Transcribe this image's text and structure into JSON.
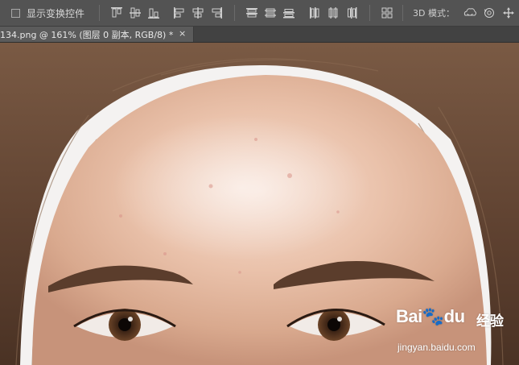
{
  "options_bar": {
    "show_transform_controls": {
      "label": "显示变换控件",
      "checked": false
    },
    "align_icons": [
      "align-top-edges-icon",
      "align-vertical-centers-icon",
      "align-bottom-edges-icon",
      "align-left-edges-icon",
      "align-horizontal-centers-icon",
      "align-right-edges-icon"
    ],
    "distribute_icons": [
      "distribute-top-icon",
      "distribute-vcenter-icon",
      "distribute-bottom-icon",
      "distribute-left-icon",
      "distribute-hcenter-icon",
      "distribute-right-icon"
    ],
    "auto_align_icon": "auto-align-layers-icon",
    "mode_label": "3D 模式：",
    "mode_icons": [
      "3d-rotate-icon",
      "3d-roll-icon",
      "3d-pan-icon"
    ]
  },
  "document_tab": {
    "title": "134.png @ 161% (图层 0 副本, RGB/8) *",
    "close_symbol": "×"
  },
  "watermark": {
    "logo": "Bai🐾du",
    "brand": "经验",
    "url": "jingyan.baidu.com"
  },
  "colors": {
    "chrome": "#535353",
    "tab_active": "#5b5b5b",
    "skin": "#e8bca5",
    "hair": "#5a3d2a"
  }
}
